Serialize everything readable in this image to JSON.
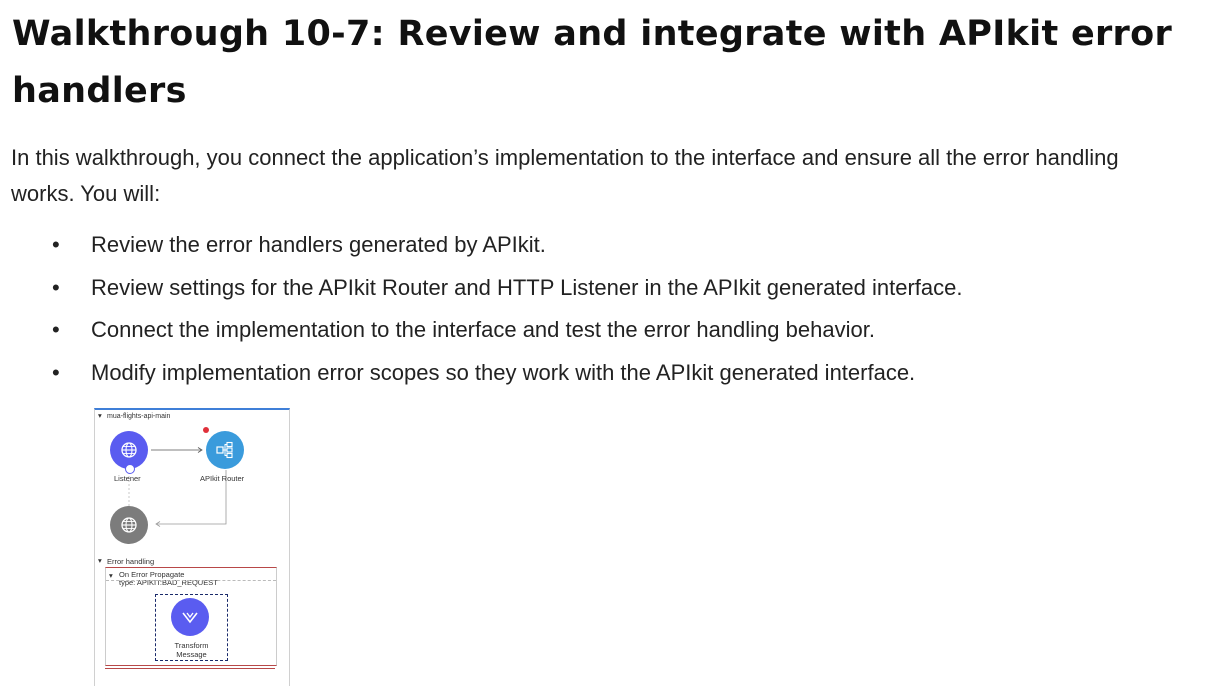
{
  "title": "Walkthrough 10-7: Review and integrate with APIkit error handlers",
  "intro": "In this walkthrough, you connect the application’s implementation to the interface and ensure all the error handling works. You will:",
  "bullets": [
    "Review the error handlers generated by APIkit.",
    "Review settings for the APIkit Router and HTTP Listener in the APIkit generated interface.",
    "Connect the implementation to the interface and test the error handling behavior.",
    "Modify implementation error scopes so they work with the APIkit generated interface."
  ],
  "bullet_glyph": "•",
  "diagram": {
    "flow_name": "mua-flights-api-main",
    "listener_label": "Listener",
    "router_label": "APIkit Router",
    "error_handling_label": "Error handling",
    "on_error_label": "On Error Propagate",
    "on_error_type": "type: APIKIT:BAD_REQUEST",
    "transform_label_line1": "Transform",
    "transform_label_line2": "Message",
    "collapse_glyph": "▾",
    "icons": [
      "globe-icon",
      "router-icon",
      "globe-icon",
      "transform-icon"
    ],
    "colors": {
      "listener": "#5a5cf0",
      "router": "#3a9bdc",
      "gray_node": "#7c7c7c",
      "transform": "#5a5cf0",
      "scope_border": "#b84848",
      "flow_border": "#3f7fd8"
    }
  }
}
